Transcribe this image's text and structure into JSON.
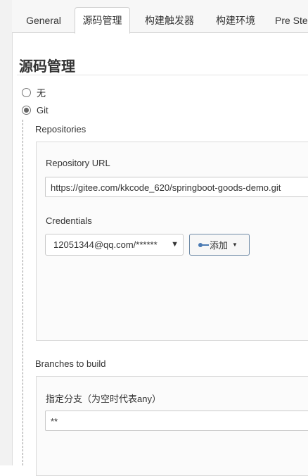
{
  "tabs": [
    {
      "label": "General"
    },
    {
      "label": "源码管理"
    },
    {
      "label": "构建触发器"
    },
    {
      "label": "构建环境"
    },
    {
      "label": "Pre Steps"
    }
  ],
  "active_tab": "源码管理",
  "section_title": "源码管理",
  "scm_options": [
    {
      "label": "无",
      "checked": false
    },
    {
      "label": "Git",
      "checked": true
    }
  ],
  "repositories": {
    "heading": "Repositories",
    "url_label": "Repository URL",
    "url_value": "https://gitee.com/kkcode_620/springboot-goods-demo.git",
    "credentials_label": "Credentials",
    "credentials_value": "12051344@qq.com/******",
    "add_button_label": "添加"
  },
  "branches": {
    "heading": "Branches to build",
    "specifier_label": "指定分支（为空时代表any）",
    "specifier_value": "**"
  },
  "icons": {
    "key": "key-icon",
    "select_caret": "chevron-down-icon",
    "button_caret": "caret-down-icon"
  },
  "colors": {
    "tab_bar_bg": "#f7f7f7",
    "border": "#cfcfcf",
    "key_icon": "#4a7ab3"
  }
}
